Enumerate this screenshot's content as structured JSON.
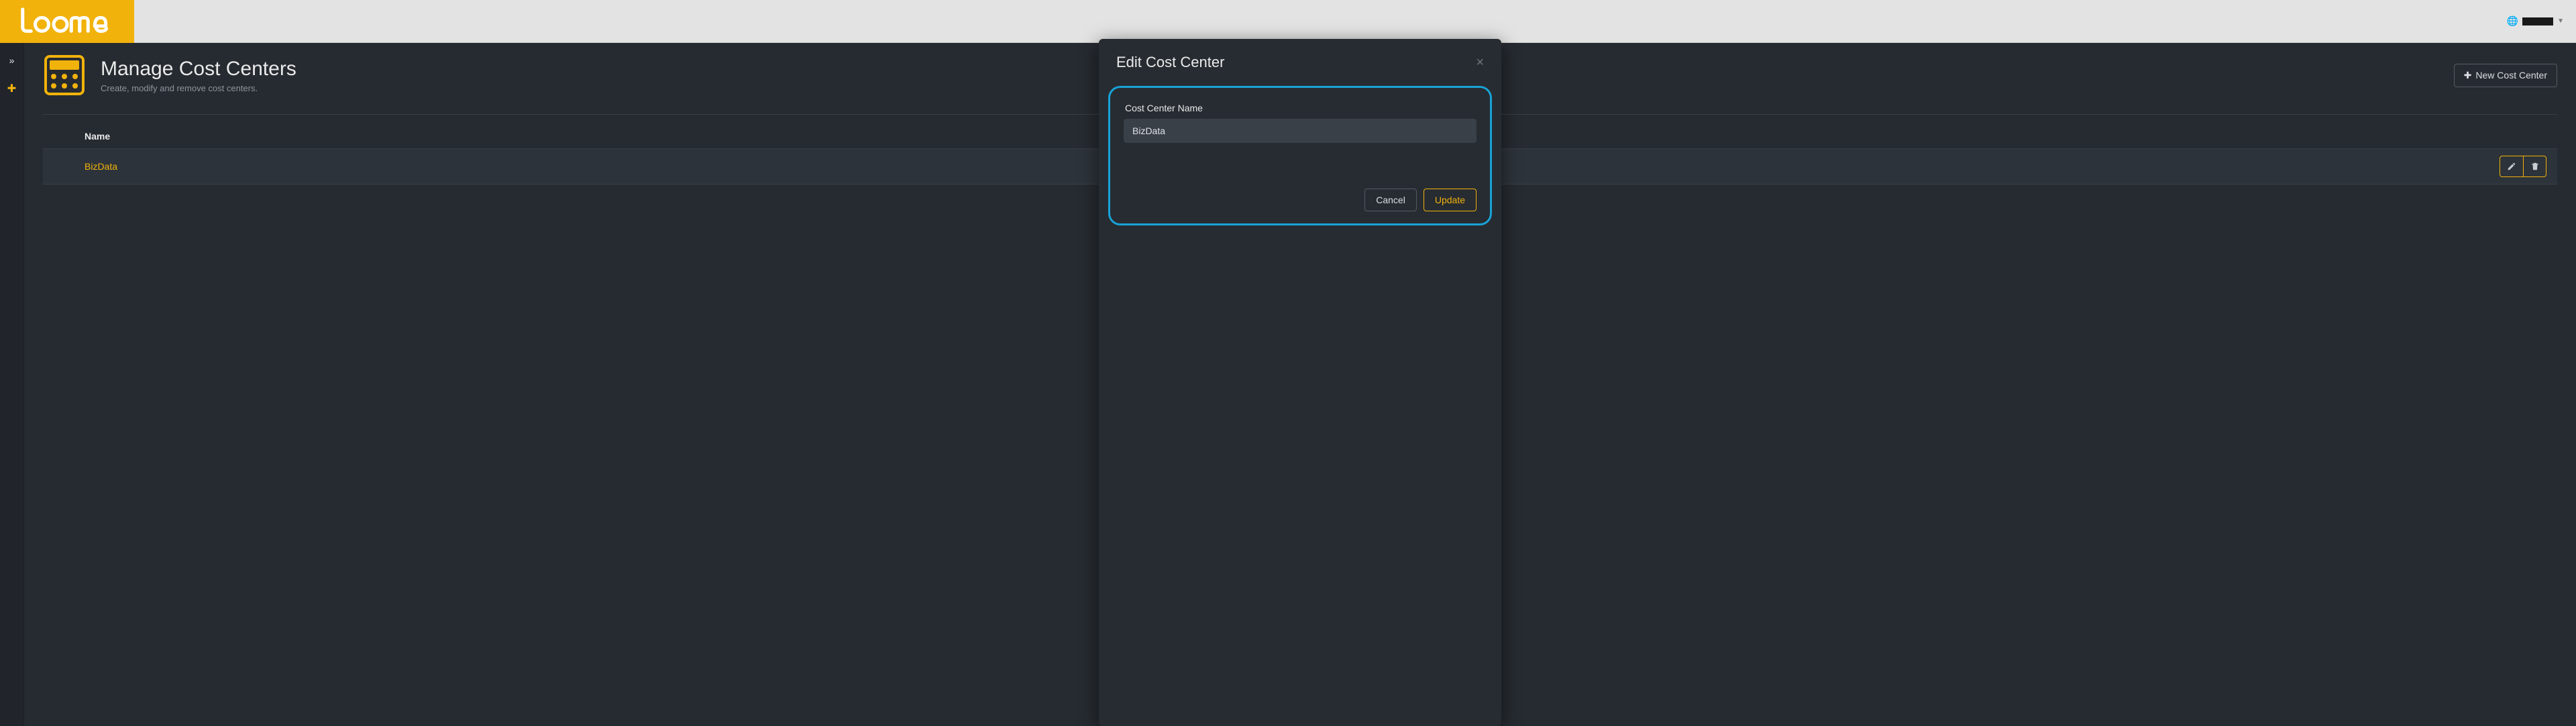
{
  "brand": {
    "name": "loome"
  },
  "header": {
    "title": "Manage Cost Centers",
    "subtitle": "Create, modify and remove cost centers.",
    "new_button": "New Cost Center"
  },
  "table": {
    "columns": {
      "name": "Name"
    },
    "rows": [
      {
        "name": "BizData"
      }
    ]
  },
  "modal": {
    "title": "Edit Cost Center",
    "field_label": "Cost Center Name",
    "field_value": "BizData",
    "cancel": "Cancel",
    "update": "Update"
  }
}
